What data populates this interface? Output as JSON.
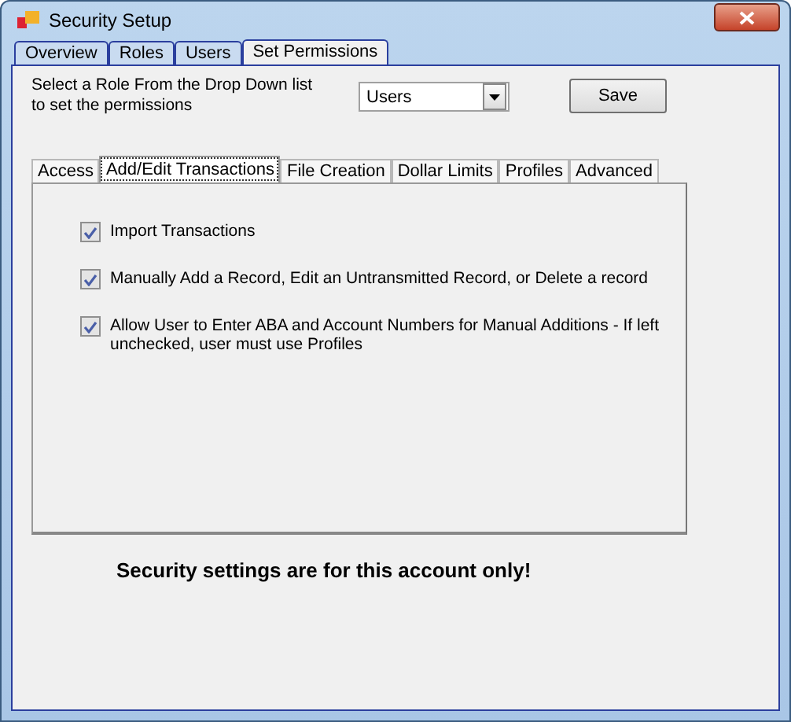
{
  "window": {
    "title": "Security Setup"
  },
  "tabs": [
    {
      "label": "Overview",
      "selected": false
    },
    {
      "label": "Roles",
      "selected": false
    },
    {
      "label": "Users",
      "selected": false
    },
    {
      "label": "Set Permissions",
      "selected": true
    }
  ],
  "role_prompt": "Select a Role From the Drop Down list to set the permissions",
  "role_select": {
    "value": "Users"
  },
  "buttons": [
    "Save"
  ],
  "permission_tabs": [
    {
      "label": "Access",
      "selected": false
    },
    {
      "label": "Add/Edit Transactions",
      "selected": true
    },
    {
      "label": "File Creation",
      "selected": false
    },
    {
      "label": "Dollar Limits",
      "selected": false
    },
    {
      "label": "Profiles",
      "selected": false
    },
    {
      "label": "Advanced",
      "selected": false
    }
  ],
  "permissions": [
    {
      "label": "Import Transactions",
      "checked": true
    },
    {
      "label": "Manually Add a Record, Edit an Untransmitted Record, or Delete a record",
      "checked": true
    },
    {
      "label": "Allow User to Enter ABA and Account Numbers for Manual Additions - If left unchecked, user must use Profiles",
      "checked": true
    }
  ],
  "notice": "Security settings are for this account only!"
}
